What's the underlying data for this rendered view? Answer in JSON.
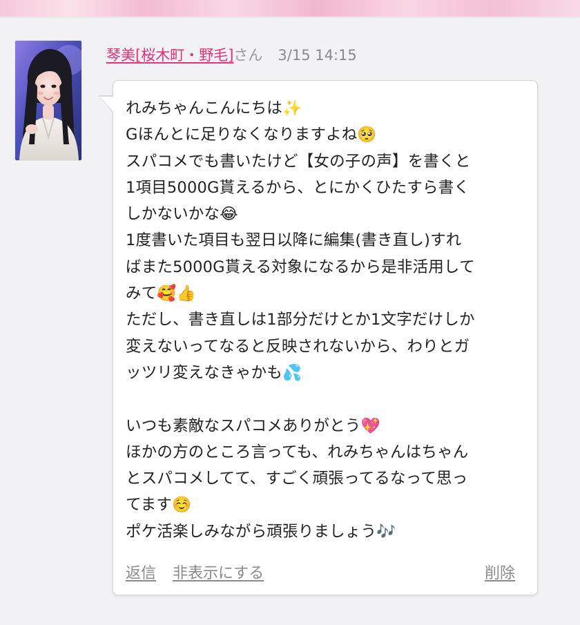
{
  "post": {
    "author_name": "琴美[桜木町・野毛]",
    "author_suffix": "さん",
    "date": "3/15 14:15",
    "lines": [
      "れみちゃんこんにちは✨",
      "Gほんとに足りなくなりますよね🥺",
      "スパコメでも書いたけど【女の子の声】を書くと",
      "1項目5000G貰えるから、とにかくひたすら書く",
      "しかないかな😂",
      "1度書いた項目も翌日以降に編集(書き直し)すれ",
      "ばまた5000G貰える対象になるから是非活用して",
      "みて🥰👍",
      "ただし、書き直しは1部分だけとか1文字だけしか",
      "変えないってなると反映されないから、わりとガ",
      "ッツリ変えなきゃかも💦",
      "",
      "いつも素敵なスパコメありがとう💖",
      "ほかの方のところ言っても、れみちゃんはちゃん",
      "とスパコメしてて、すごく頑張ってるなって思っ",
      "てます☺️",
      "ポケ活楽しみながら頑張りましょう🎶"
    ]
  },
  "actions": {
    "reply": "返信",
    "hide": "非表示にする",
    "delete": "削除"
  },
  "colors": {
    "author_link": "#e3317b",
    "meta_text": "#8a8a8a",
    "body_text": "#222222",
    "page_bg": "#f2f2f4"
  },
  "icons": {
    "avatar": "profile-photo"
  }
}
